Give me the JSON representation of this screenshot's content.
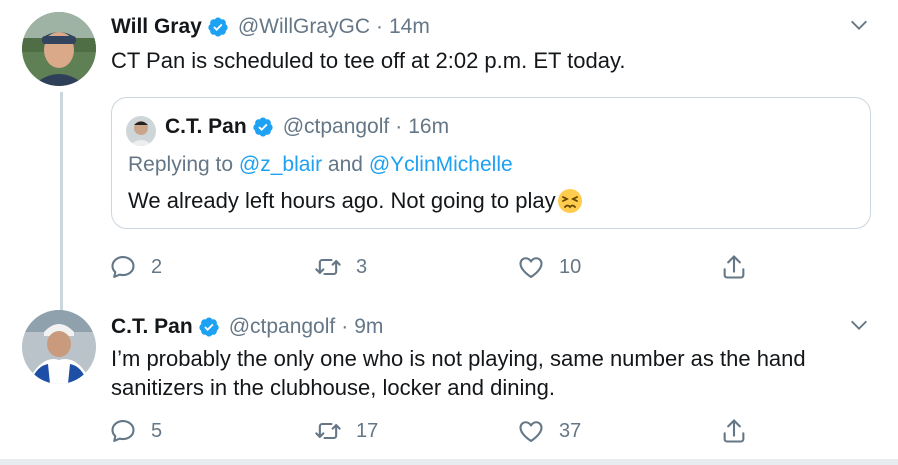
{
  "tweets": [
    {
      "display_name": "Will Gray",
      "handle": "@WillGrayGC",
      "time": "14m",
      "text": "CT Pan is scheduled to tee off at 2:02 p.m. ET today.",
      "quote": {
        "display_name": "C.T. Pan",
        "handle": "@ctpangolf",
        "time": "16m",
        "replying_prefix": "Replying to ",
        "replying_user_1": "@z_blair",
        "replying_and": " and ",
        "replying_user_2": "@YclinMichelle",
        "text": "We already left hours ago. Not going to play"
      },
      "replies": "2",
      "retweets": "3",
      "likes": "10"
    },
    {
      "display_name": "C.T. Pan",
      "handle": "@ctpangolf",
      "time": "9m",
      "text_line_1": "I’m probably the only one who is not playing, same number as the hand",
      "text_line_2": "sanitizers in the clubhouse, locker and dining.",
      "replies": "5",
      "retweets": "17",
      "likes": "37"
    }
  ],
  "separator": "·",
  "colors": {
    "accent": "#1da1f2",
    "secondary_text": "#657786",
    "primary_text": "#14171a",
    "border": "#ccd6dd"
  },
  "icons": [
    "verified-badge-icon",
    "chevron-down-icon",
    "reply-icon",
    "retweet-icon",
    "like-icon",
    "share-icon",
    "persevering-face-emoji"
  ]
}
